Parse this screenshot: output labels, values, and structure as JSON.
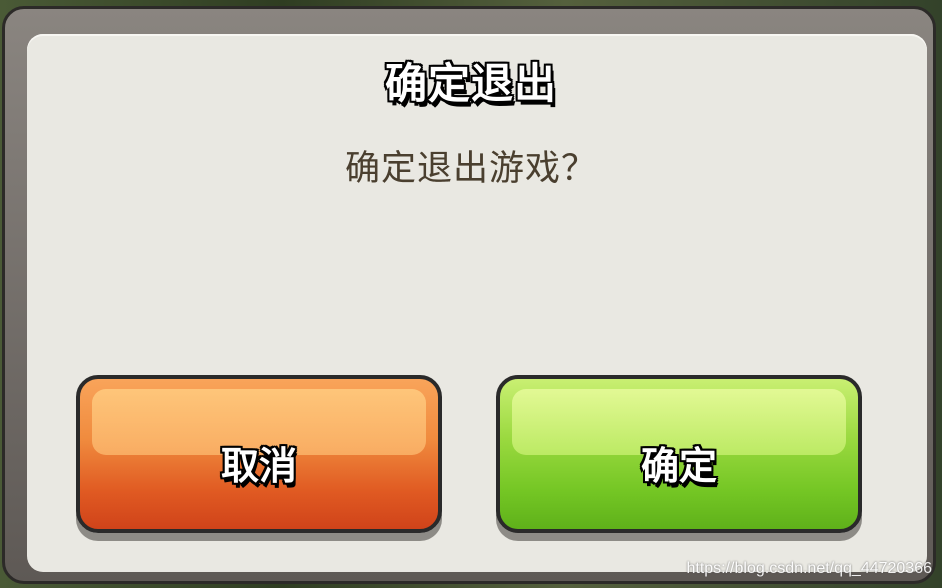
{
  "dialog": {
    "title": "确定退出",
    "message": "确定退出游戏？"
  },
  "buttons": {
    "cancel_label": "取消",
    "confirm_label": "确定"
  },
  "watermark": "https://blog.csdn.net/qq_44720366",
  "colors": {
    "panel": "#e9e8e2",
    "frame": "#5e5955",
    "cancel_button": "#e05a22",
    "confirm_button": "#74c624",
    "message_text": "#4a3f2f"
  }
}
